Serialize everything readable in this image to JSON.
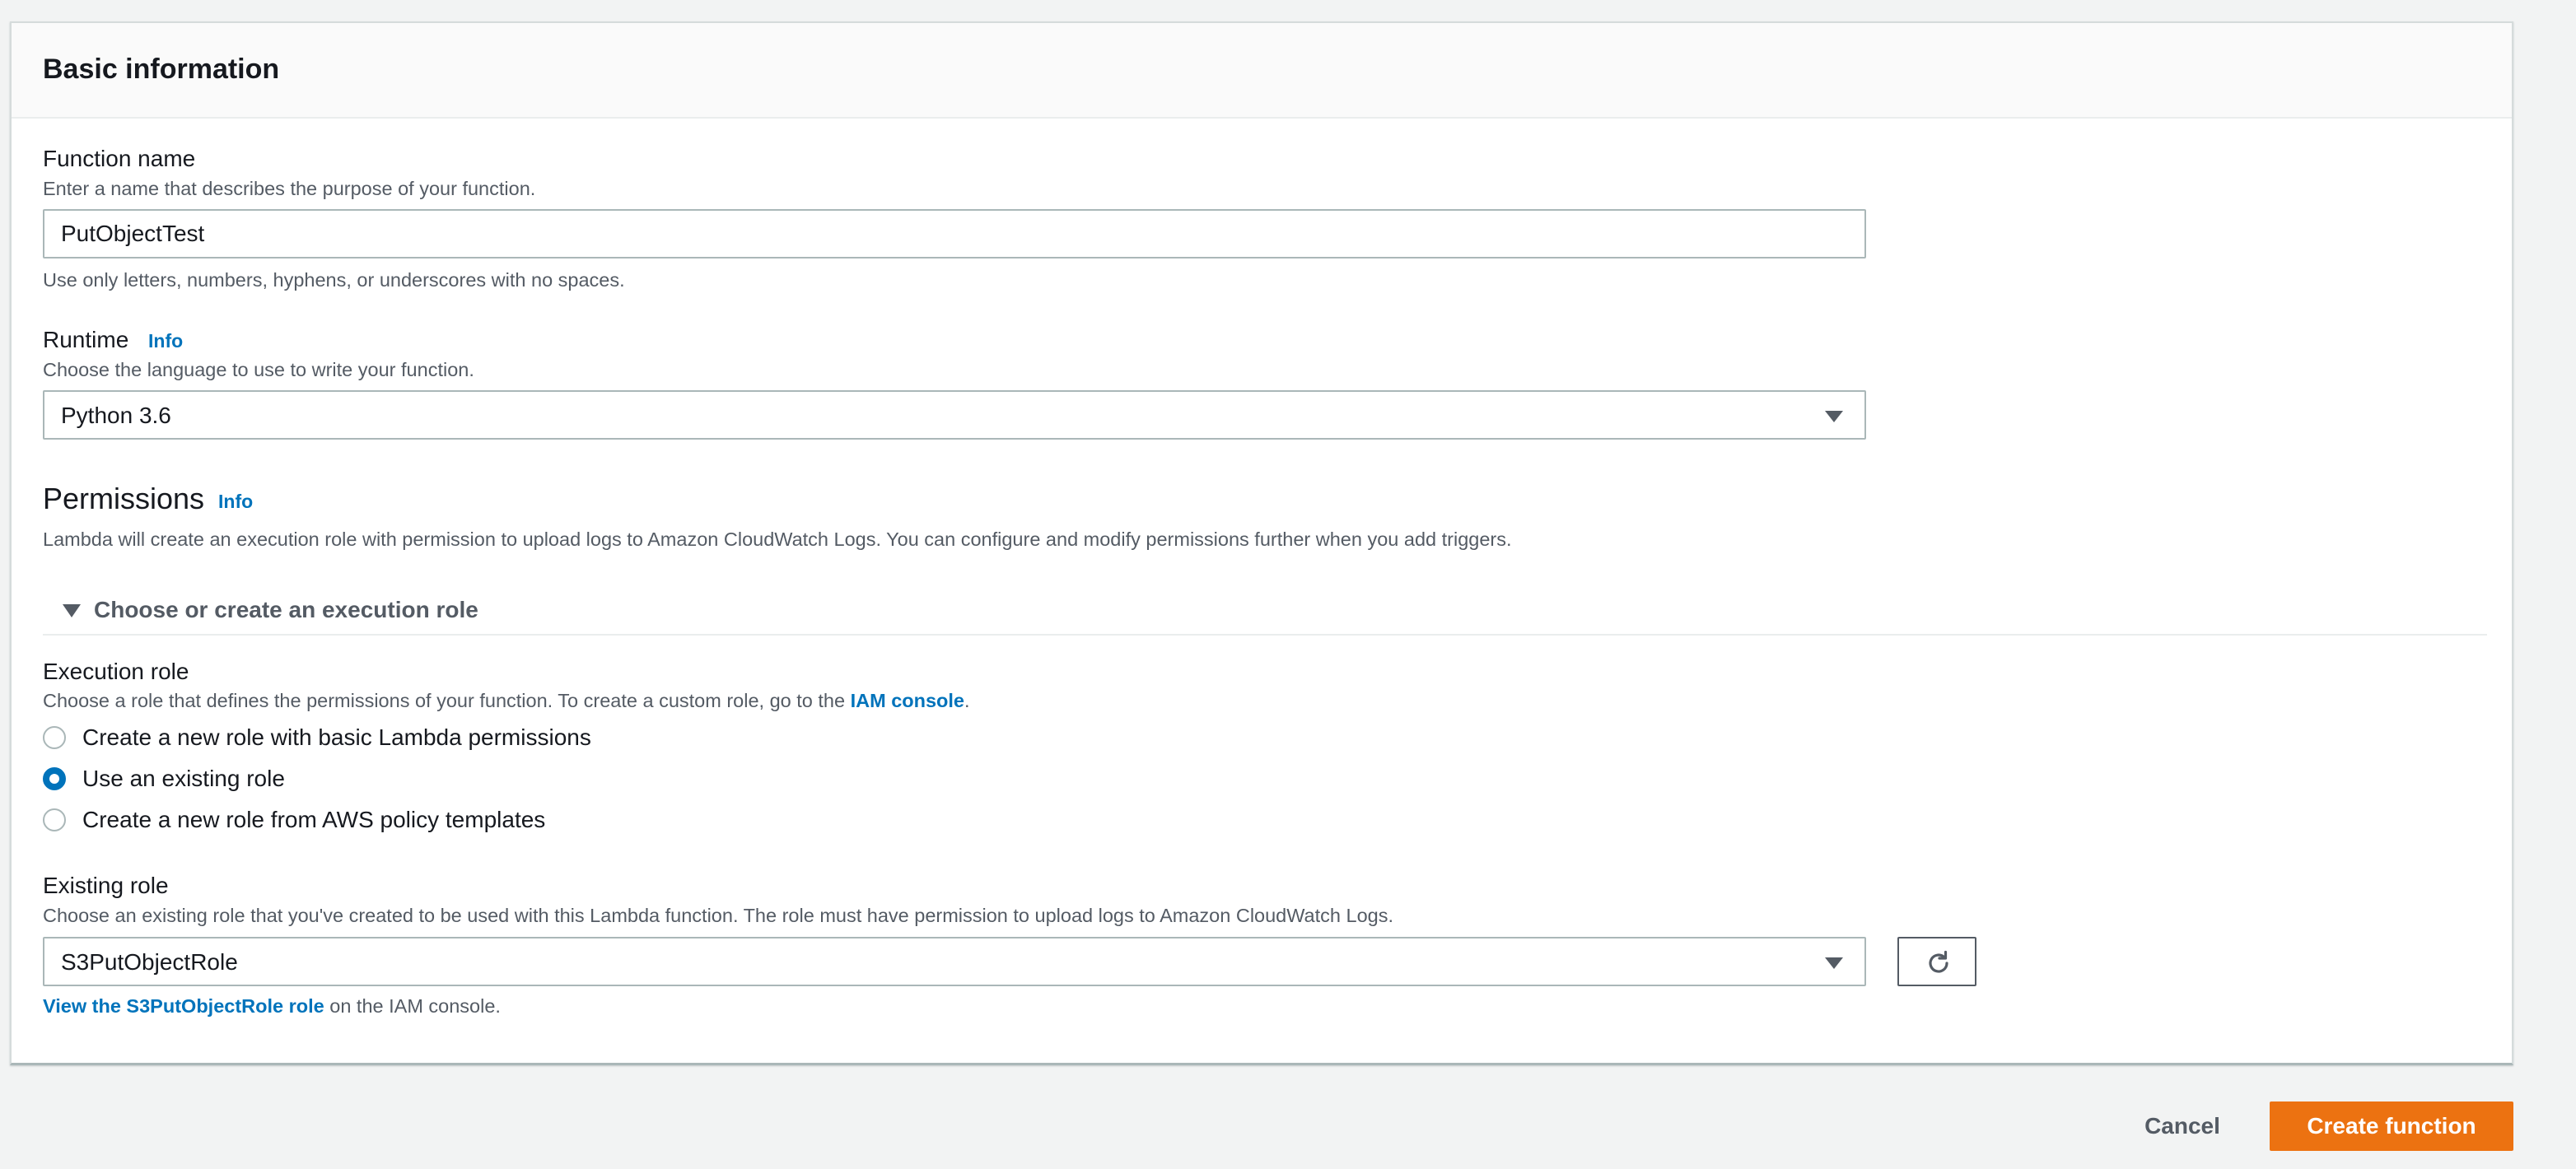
{
  "panel": {
    "title": "Basic information"
  },
  "function_name": {
    "label": "Function name",
    "description": "Enter a name that describes the purpose of your function.",
    "value": "PutObjectTest",
    "constraint": "Use only letters, numbers, hyphens, or underscores with no spaces."
  },
  "runtime": {
    "label": "Runtime",
    "info": "Info",
    "description": "Choose the language to use to write your function.",
    "selected": "Python 3.6"
  },
  "permissions": {
    "title": "Permissions",
    "info": "Info",
    "description": "Lambda will create an execution role with permission to upload logs to Amazon CloudWatch Logs. You can configure and modify permissions further when you add triggers.",
    "expander_label": "Choose or create an execution role"
  },
  "execution_role": {
    "label": "Execution role",
    "description_prefix": "Choose a role that defines the permissions of your function. To create a custom role, go to the ",
    "description_link": "IAM console",
    "description_suffix": ".",
    "options": [
      {
        "label": "Create a new role with basic Lambda permissions",
        "checked": false
      },
      {
        "label": "Use an existing role",
        "checked": true
      },
      {
        "label": "Create a new role from AWS policy templates",
        "checked": false
      }
    ]
  },
  "existing_role": {
    "label": "Existing role",
    "description": "Choose an existing role that you've created to be used with this Lambda function. The role must have permission to upload logs to Amazon CloudWatch Logs.",
    "selected": "S3PutObjectRole",
    "view_link": "View the S3PutObjectRole role",
    "view_suffix": " on the IAM console."
  },
  "footer": {
    "cancel_label": "Cancel",
    "create_label": "Create function"
  },
  "colors": {
    "accent": "#0073bb",
    "primary_button": "#ec7211",
    "background": "#f2f3f3"
  },
  "icons": {
    "runtime_dropdown": "caret-down-icon",
    "role_dropdown": "caret-down-icon",
    "expander": "caret-down-icon",
    "refresh": "refresh-icon"
  }
}
